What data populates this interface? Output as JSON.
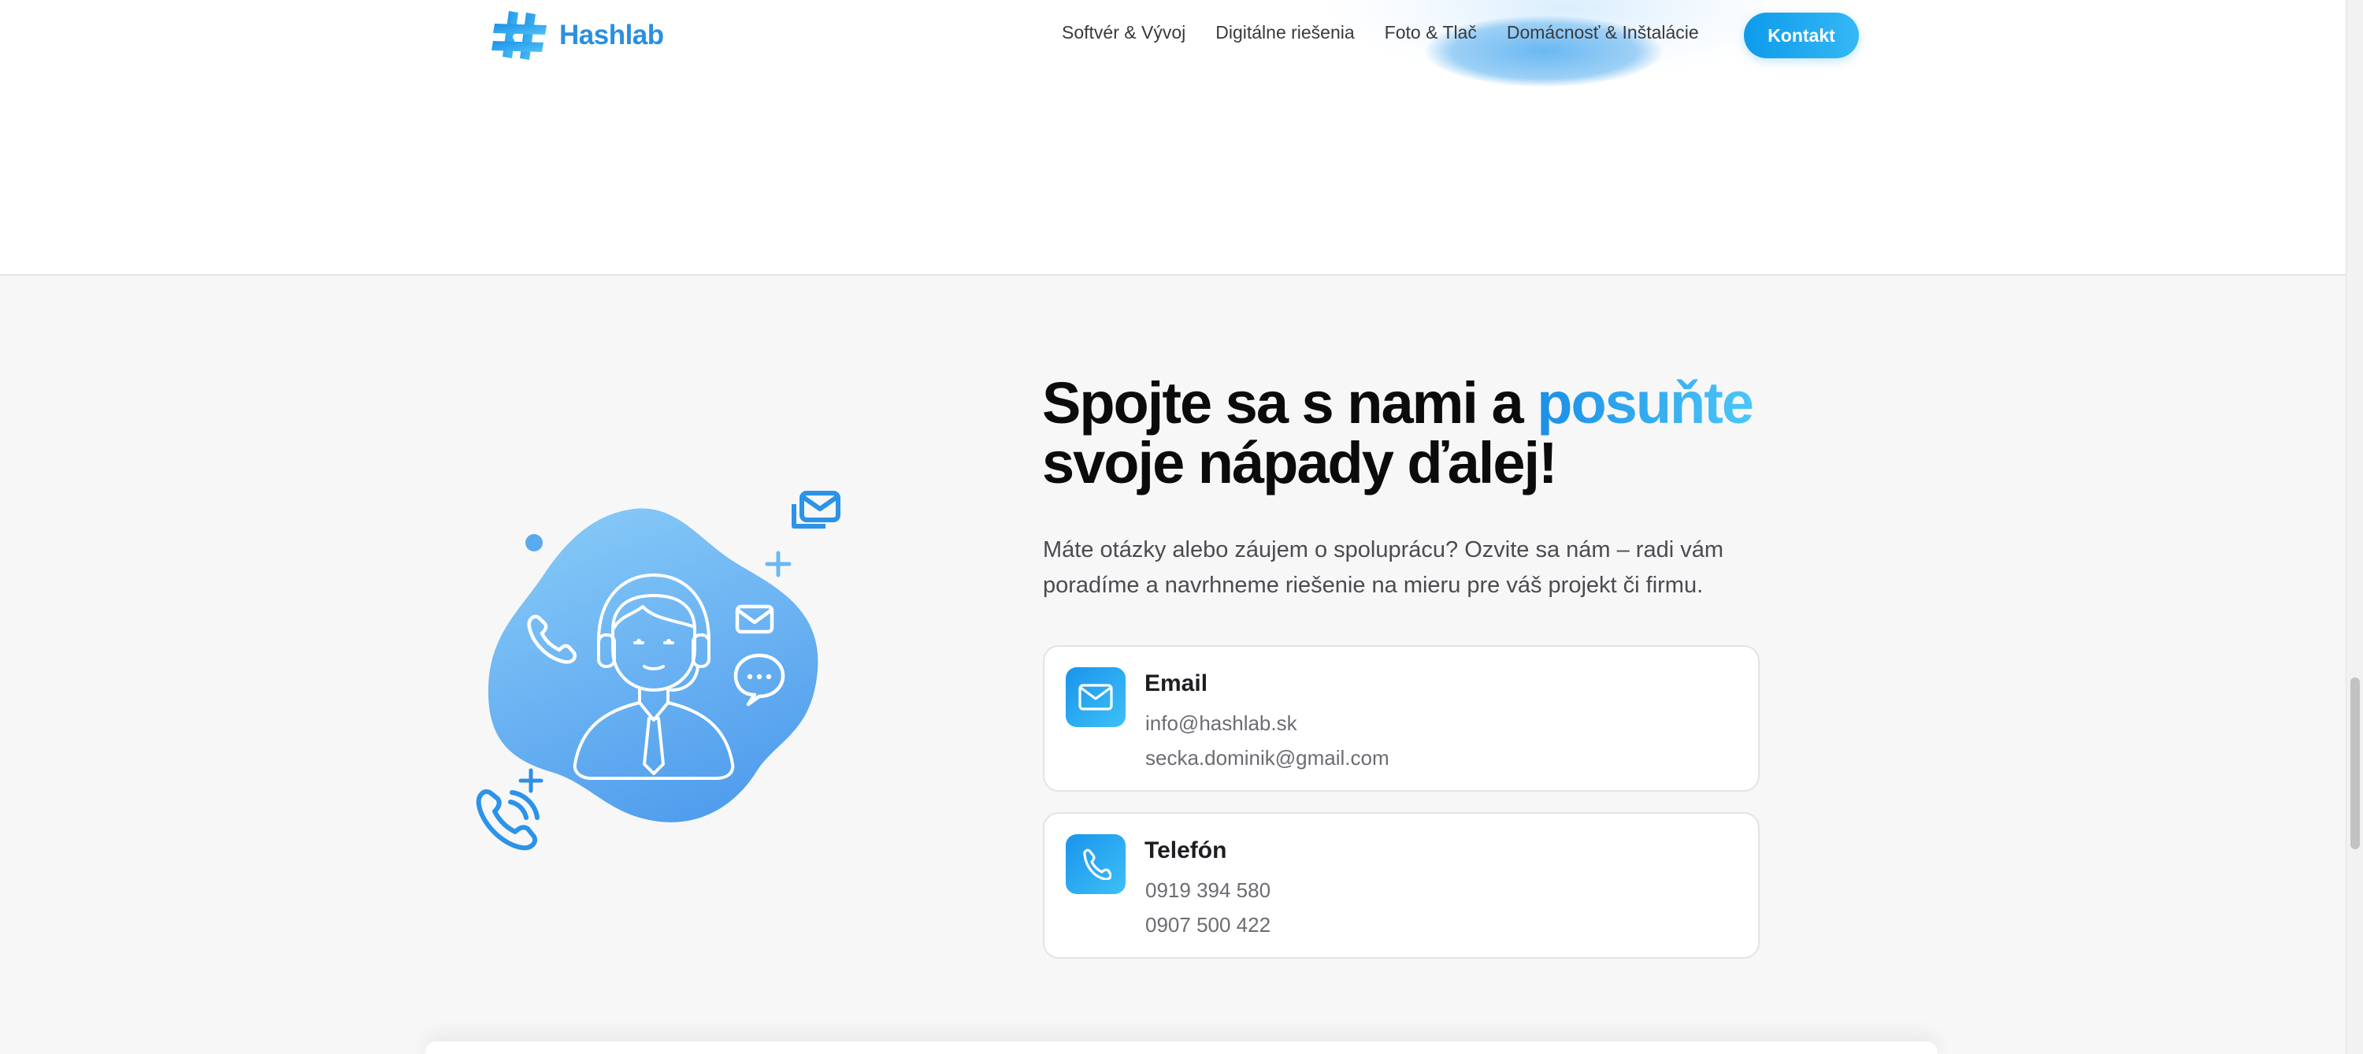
{
  "header": {
    "logo_text": "Hashlab",
    "nav": [
      {
        "label": "Softvér & Vývoj"
      },
      {
        "label": "Digitálne riešenia"
      },
      {
        "label": "Foto & Tlač"
      },
      {
        "label": "Domácnosť & Inštalácie"
      }
    ],
    "cta_label": "Kontakt"
  },
  "contact": {
    "headline_part1": "Spojte sa s nami a ",
    "headline_accent": "posuňte",
    "headline_part2": "svoje nápady ďalej!",
    "lead": "Máte otázky alebo záujem o spoluprácu? Ozvite sa nám – radi vám poradíme a navrhneme riešenie na mieru pre váš projekt či firmu.",
    "cards": [
      {
        "title": "Email",
        "line1": "info@hashlab.sk",
        "line2": "secka.dominik@gmail.com",
        "icon": "mail-icon"
      },
      {
        "title": "Telefón",
        "line1": "0919 394 580",
        "line2": "0907 500 422",
        "icon": "phone-icon"
      }
    ]
  },
  "colors": {
    "accent": "#1a94ec",
    "accent_light": "#3dc0f6",
    "background": "#f7f7f8"
  }
}
